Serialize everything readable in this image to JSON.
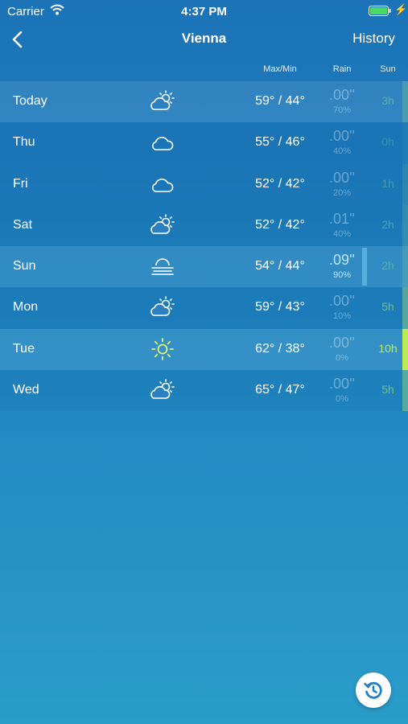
{
  "status_bar": {
    "carrier": "Carrier",
    "time": "4:37 PM",
    "wifi_icon": "wifi-icon",
    "battery_icon": "battery-icon",
    "charging_icon": "charging-bolt-icon",
    "battery_level": 1.0,
    "battery_color": "#4cd964"
  },
  "nav": {
    "back_icon": "chevron-left-icon",
    "title": "Vienna",
    "history_label": "History"
  },
  "columns": {
    "max_min": "Max/Min",
    "rain": "Rain",
    "sun": "Sun"
  },
  "forecast": [
    {
      "day": "Today",
      "icon": "partly-cloudy-icon",
      "temps": "59° / 44°",
      "rain_amount": ".00''",
      "rain_chance": "70%",
      "sun_hours": "3h",
      "sun_fraction": 0.3
    },
    {
      "day": "Thu",
      "icon": "cloudy-icon",
      "temps": "55° / 46°",
      "rain_amount": ".00''",
      "rain_chance": "40%",
      "sun_hours": "0h",
      "sun_fraction": 0.0
    },
    {
      "day": "Fri",
      "icon": "cloudy-icon",
      "temps": "52° / 42°",
      "rain_amount": ".00''",
      "rain_chance": "20%",
      "sun_hours": "1h",
      "sun_fraction": 0.1
    },
    {
      "day": "Sat",
      "icon": "partly-cloudy-icon",
      "temps": "52° / 42°",
      "rain_amount": ".01''",
      "rain_chance": "40%",
      "sun_hours": "2h",
      "sun_fraction": 0.2
    },
    {
      "day": "Sun",
      "icon": "fog-icon",
      "temps": "54° / 44°",
      "rain_amount": ".09''",
      "rain_chance": "90%",
      "sun_hours": "2h",
      "sun_fraction": 0.2
    },
    {
      "day": "Mon",
      "icon": "partly-cloudy-icon",
      "temps": "59° / 43°",
      "rain_amount": ".00''",
      "rain_chance": "10%",
      "sun_hours": "5h",
      "sun_fraction": 0.5
    },
    {
      "day": "Tue",
      "icon": "sunny-icon",
      "temps": "62° / 38°",
      "rain_amount": ".00''",
      "rain_chance": "0%",
      "sun_hours": "10h",
      "sun_fraction": 1.0
    },
    {
      "day": "Wed",
      "icon": "partly-cloudy-icon",
      "temps": "65° / 47°",
      "rain_amount": ".00''",
      "rain_chance": "0%",
      "sun_hours": "5h",
      "sun_fraction": 0.5
    }
  ],
  "history_fab_icon": "history-icon"
}
